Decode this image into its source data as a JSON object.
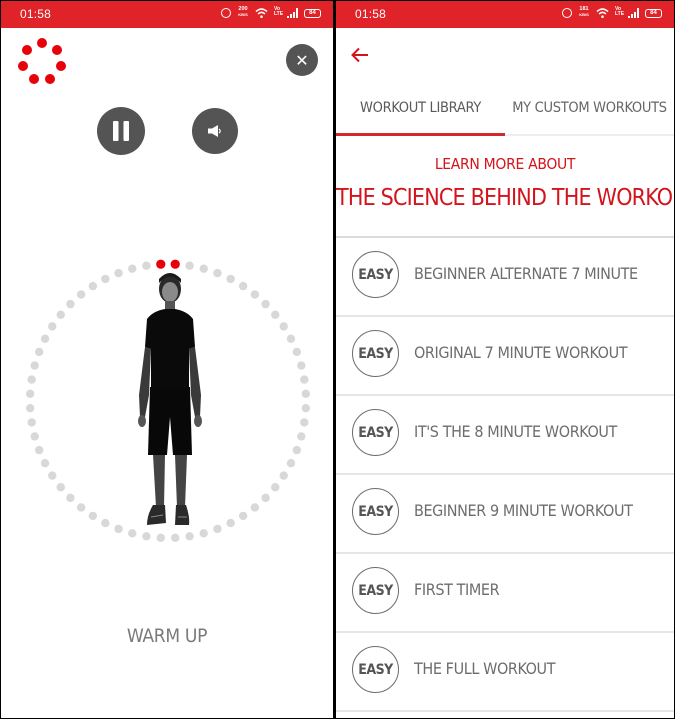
{
  "colors": {
    "accent_red": "#e02329",
    "text_red": "#d4141c",
    "button_gray": "#545454",
    "ring_dot_gray": "#d8d8d8",
    "ring_dot_active": "#e8000b"
  },
  "left_screen": {
    "status_bar": {
      "time": "01:58",
      "net_speed_value": "200",
      "net_speed_unit": "KB/S",
      "volte": "Vo LTE",
      "battery": "84",
      "icons": [
        "alarm-icon",
        "network-speed",
        "wifi-icon",
        "volte-icon",
        "signal-icon",
        "battery-icon"
      ]
    },
    "loading_indicator": "loading-dots-icon",
    "close_button": {
      "icon": "close-icon",
      "glyph": "✕"
    },
    "pause_button": {
      "icon": "pause-icon"
    },
    "volume_button": {
      "icon": "speaker-icon"
    },
    "progress_ring": {
      "total_dots": 60,
      "completed_dots": 2
    },
    "exercise_image": "person-standing",
    "phase_label": "WARM UP"
  },
  "right_screen": {
    "status_bar": {
      "time": "01:58",
      "net_speed_value": "181",
      "net_speed_unit": "KB/S",
      "volte": "Vo LTE",
      "battery": "84",
      "icons": [
        "alarm-icon",
        "network-speed",
        "wifi-icon",
        "volte-icon",
        "signal-icon",
        "battery-icon"
      ]
    },
    "back_button": {
      "icon": "back-arrow-icon",
      "glyph": "←"
    },
    "tabs": [
      {
        "label": "WORKOUT LIBRARY",
        "active": true
      },
      {
        "label": "MY CUSTOM WORKOUTS",
        "active": false
      }
    ],
    "banner": {
      "subtitle": "LEARN MORE ABOUT",
      "title": "THE SCIENCE BEHIND THE WORKOUTS"
    },
    "workouts": [
      {
        "difficulty": "EASY",
        "title": "BEGINNER ALTERNATE 7 MINUTE"
      },
      {
        "difficulty": "EASY",
        "title": "ORIGINAL 7 MINUTE WORKOUT"
      },
      {
        "difficulty": "EASY",
        "title": "IT'S THE 8 MINUTE WORKOUT"
      },
      {
        "difficulty": "EASY",
        "title": "BEGINNER 9 MINUTE WORKOUT"
      },
      {
        "difficulty": "EASY",
        "title": "FIRST TIMER"
      },
      {
        "difficulty": "EASY",
        "title": "THE FULL WORKOUT"
      }
    ]
  }
}
